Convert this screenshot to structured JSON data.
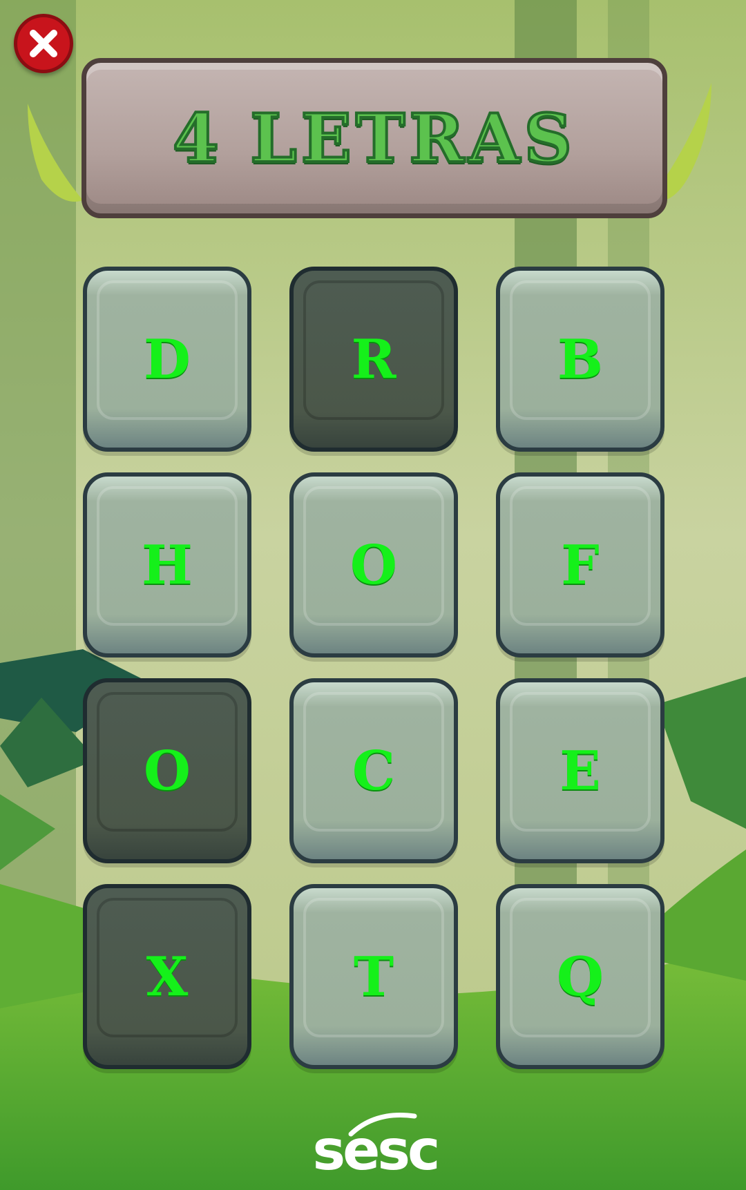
{
  "game": {
    "title": "4 LETRAS",
    "close_icon": "close-icon",
    "tiles": [
      {
        "letter": "D",
        "state": "light"
      },
      {
        "letter": "R",
        "state": "dark"
      },
      {
        "letter": "B",
        "state": "light"
      },
      {
        "letter": "H",
        "state": "light"
      },
      {
        "letter": "O",
        "state": "light"
      },
      {
        "letter": "F",
        "state": "light"
      },
      {
        "letter": "O",
        "state": "dark"
      },
      {
        "letter": "C",
        "state": "light"
      },
      {
        "letter": "E",
        "state": "light"
      },
      {
        "letter": "X",
        "state": "dark"
      },
      {
        "letter": "T",
        "state": "light"
      },
      {
        "letter": "Q",
        "state": "light"
      }
    ],
    "footer_logo": "sesc"
  },
  "colors": {
    "letter": "#15f01a",
    "title": "#5cc24e",
    "close_button": "#c8141c"
  }
}
